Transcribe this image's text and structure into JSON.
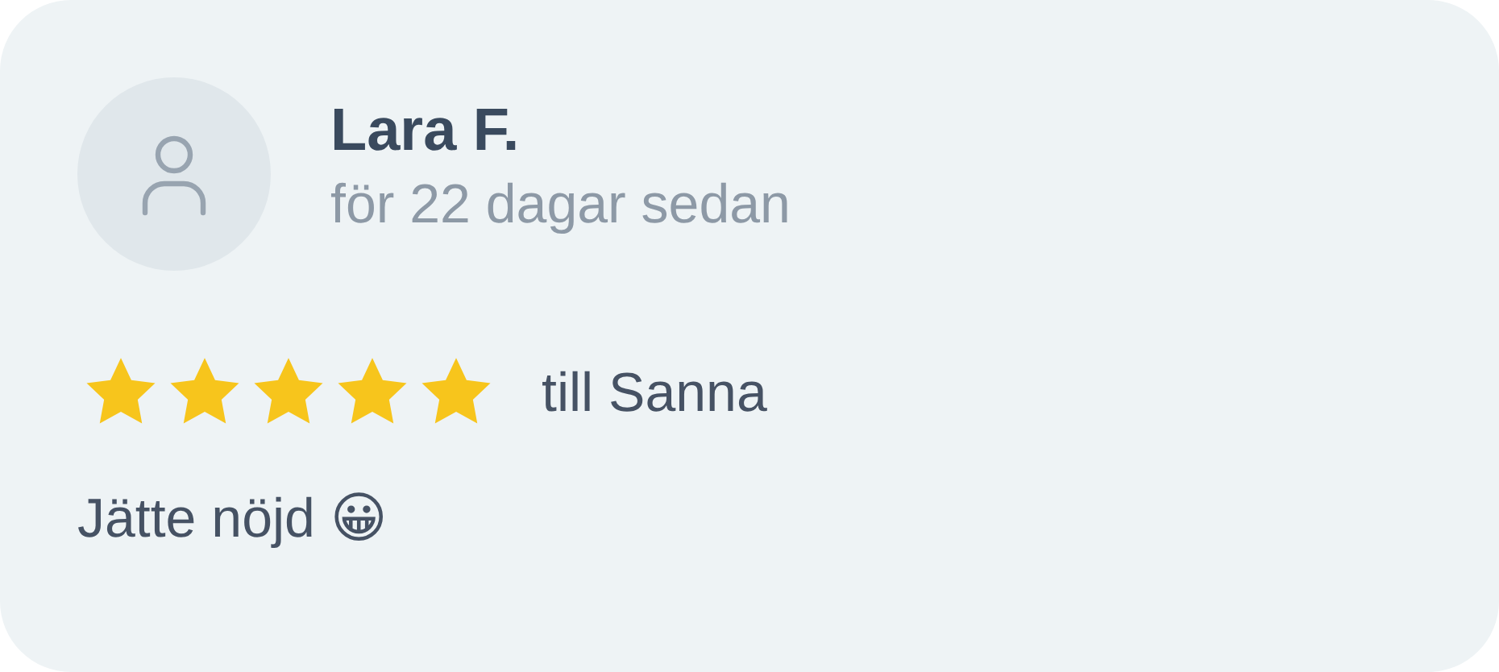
{
  "review": {
    "author": "Lara F.",
    "time": "för 22 dagar sedan",
    "stars": 5,
    "recipient": "till Sanna",
    "text": "Jätte nöjd 😀"
  }
}
